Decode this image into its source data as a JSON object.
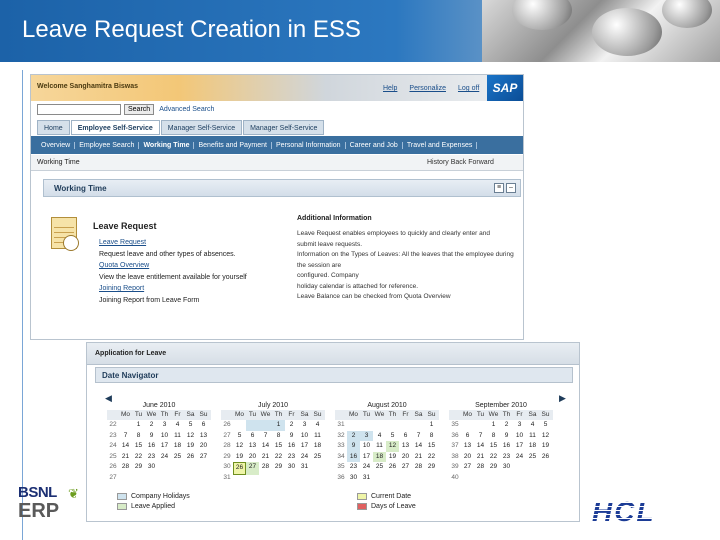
{
  "slide": {
    "title": "Leave Request Creation in ESS"
  },
  "portal": {
    "welcome": "Welcome Sanghamitra Biswas",
    "top_links": [
      "Help",
      "Personalize",
      "Log off"
    ],
    "logo": "SAP",
    "search": {
      "button": "Search",
      "advanced": "Advanced Search"
    },
    "tabs": [
      "Home",
      "Employee Self-Service",
      "Manager Self-Service",
      "Manager Self-Service"
    ],
    "nav": [
      "Overview",
      "Employee Search",
      "Working Time",
      "Benefits and Payment",
      "Personal Information",
      "Career and Job",
      "Travel and Expenses"
    ],
    "breadcrumb": "Working Time",
    "history": "History",
    "back": "Back",
    "forward": "Forward",
    "panel_title": "Working Time",
    "leave_request_title": "Leave Request",
    "items": [
      {
        "text": "Leave Request",
        "link": true
      },
      {
        "text": "Request leave and other types of absences.",
        "link": false
      },
      {
        "text": "Quota Overview",
        "link": true
      },
      {
        "text": "View the leave entitlement available for yourself",
        "link": false
      },
      {
        "text": "Joining Report",
        "link": true
      },
      {
        "text": "Joining Report from Leave Form",
        "link": false
      }
    ],
    "additional_info_title": "Additional Information",
    "additional_info_lines": [
      "Leave Request enables employees to quickly and clearly enter and",
      "submit leave requests.",
      "Information on the Types of Leaves: All the leaves that the employee during the session are",
      "configured. Company",
      "holiday calendar is attached for reference.",
      "Leave Balance can be checked from Quota Overview"
    ]
  },
  "leave": {
    "app_title": "Application for Leave",
    "date_navigator": "Date Navigator",
    "day_headers": [
      "Mo",
      "Tu",
      "We",
      "Th",
      "Fr",
      "Sa",
      "Su"
    ],
    "months": [
      {
        "name": "June 2010",
        "weeks": [
          [
            "22",
            "",
            "1",
            "2",
            "3",
            "4",
            "5",
            "6"
          ],
          [
            "23",
            "7",
            "8",
            "9",
            "10",
            "11",
            "12",
            "13"
          ],
          [
            "24",
            "14",
            "15",
            "16",
            "17",
            "18",
            "19",
            "20"
          ],
          [
            "25",
            "21",
            "22",
            "23",
            "24",
            "25",
            "26",
            "27"
          ],
          [
            "26",
            "28",
            "29",
            "30",
            "",
            "",
            "",
            ""
          ],
          [
            "27",
            "",
            "",
            "",
            "",
            "",
            "",
            ""
          ]
        ]
      },
      {
        "name": "July 2010",
        "weeks": [
          [
            "26",
            "",
            "",
            "",
            "1",
            "2",
            "3",
            "4"
          ],
          [
            "27",
            "5",
            "6",
            "7",
            "8",
            "9",
            "10",
            "11"
          ],
          [
            "28",
            "12",
            "13",
            "14",
            "15",
            "16",
            "17",
            "18"
          ],
          [
            "29",
            "19",
            "20",
            "21",
            "22",
            "23",
            "24",
            "25"
          ],
          [
            "30",
            "26",
            "27",
            "28",
            "29",
            "30",
            "31",
            ""
          ],
          [
            "31",
            "",
            "",
            "",
            "",
            "",
            "",
            ""
          ]
        ]
      },
      {
        "name": "August 2010",
        "weeks": [
          [
            "31",
            "",
            "",
            "",
            "",
            "",
            "",
            "1"
          ],
          [
            "32",
            "2",
            "3",
            "4",
            "5",
            "6",
            "7",
            "8"
          ],
          [
            "33",
            "9",
            "10",
            "11",
            "12",
            "13",
            "14",
            "15"
          ],
          [
            "34",
            "16",
            "17",
            "18",
            "19",
            "20",
            "21",
            "22"
          ],
          [
            "35",
            "23",
            "24",
            "25",
            "26",
            "27",
            "28",
            "29"
          ],
          [
            "36",
            "30",
            "31",
            "",
            "",
            "",
            "",
            ""
          ]
        ]
      },
      {
        "name": "September 2010",
        "weeks": [
          [
            "35",
            "",
            "",
            "1",
            "2",
            "3",
            "4",
            "5"
          ],
          [
            "36",
            "6",
            "7",
            "8",
            "9",
            "10",
            "11",
            "12"
          ],
          [
            "37",
            "13",
            "14",
            "15",
            "16",
            "17",
            "18",
            "19"
          ],
          [
            "38",
            "20",
            "21",
            "22",
            "23",
            "24",
            "25",
            "26"
          ],
          [
            "39",
            "27",
            "28",
            "29",
            "30",
            "",
            "",
            ""
          ],
          [
            "40",
            "",
            "",
            "",
            "",
            "",
            "",
            ""
          ]
        ]
      }
    ],
    "legend": [
      "Company Holidays",
      "Current Date",
      "Leave Applied",
      "Days of Leave"
    ]
  },
  "footer": {
    "left_logo_top": "BSNL",
    "left_logo_bottom": "ERP",
    "right_logo": "HCL"
  }
}
